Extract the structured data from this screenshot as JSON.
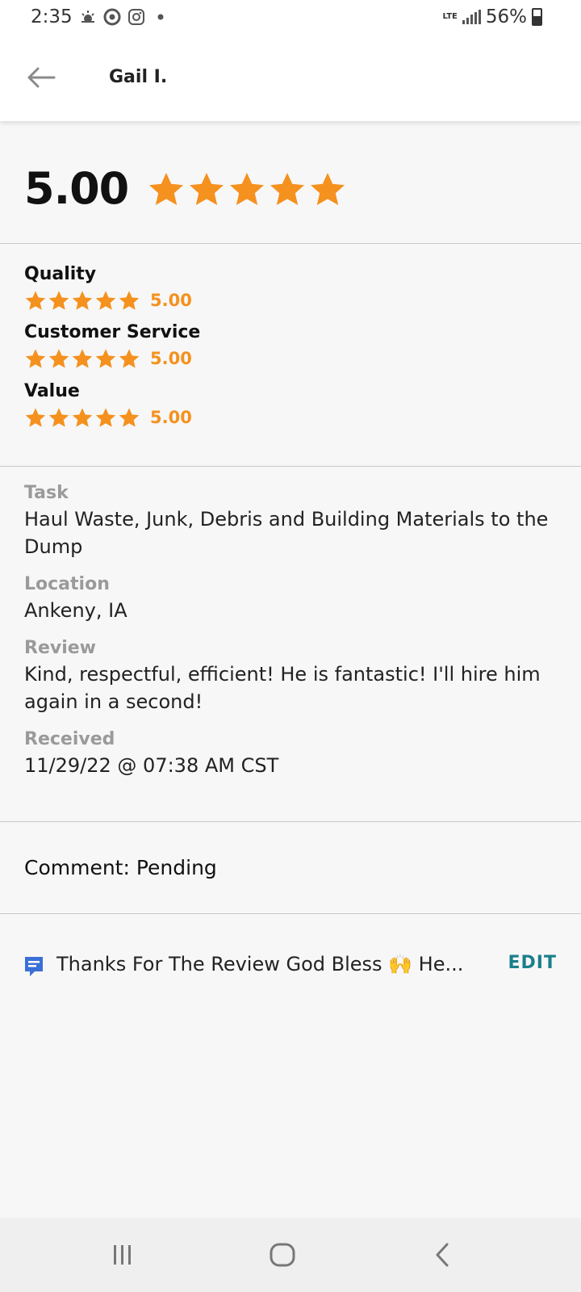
{
  "status_bar": {
    "time": "2:35",
    "network": "LTE",
    "battery_percent": "56%",
    "battery_level": 0.56,
    "icons": [
      "weather-icon",
      "chrome-icon",
      "instagram-icon",
      "notification-dot-icon",
      "signal-icon",
      "battery-icon"
    ]
  },
  "app_bar": {
    "title": "Gail I.",
    "back_icon": "arrow-left-icon"
  },
  "overall": {
    "rating_text": "5.00",
    "rating": 5,
    "max_rating": 5
  },
  "categories": [
    {
      "label": "Quality",
      "value_text": "5.00",
      "rating": 5
    },
    {
      "label": "Customer Service",
      "value_text": "5.00",
      "rating": 5
    },
    {
      "label": "Value",
      "value_text": "5.00",
      "rating": 5
    }
  ],
  "details": {
    "task_label": "Task",
    "task_line1": "Haul Waste, Junk, Debris and Building Materials to the",
    "task_line2": "Dump",
    "location_label": "Location",
    "location_value": "Ankeny, IA",
    "review_label": "Review",
    "review_line1": "Kind, respectful, efficient! He is fantastic! I'll hire him",
    "review_line2": "again in a second!",
    "received_label": "Received",
    "received_value": "11/29/22 @ 07:38 AM CST"
  },
  "comment": {
    "text": "Comment: Pending"
  },
  "reply": {
    "icon": "comment-icon",
    "text": "Thanks For The Review God Bless 🙌 He...",
    "edit_label": "EDIT"
  },
  "colors": {
    "star": "#f5911e",
    "edit": "#1a7f8a",
    "reply_icon": "#3b6fd8"
  },
  "nav_bar": {
    "icons": [
      "recents-icon",
      "home-icon",
      "back-icon"
    ]
  }
}
